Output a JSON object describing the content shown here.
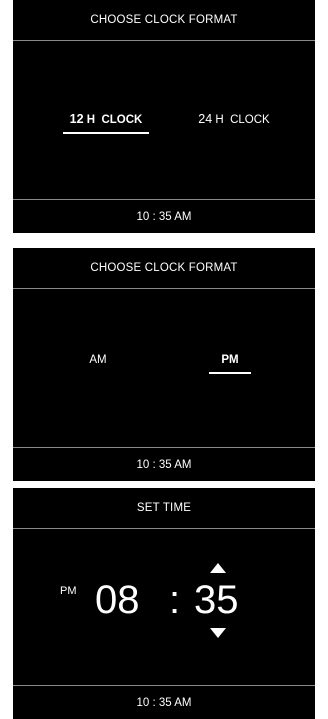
{
  "screens": [
    {
      "header": "CHOOSE CLOCK FORMAT",
      "options": [
        {
          "num": "12",
          "unit": "H",
          "label": "CLOCK",
          "selected": true
        },
        {
          "num": "24",
          "unit": "H",
          "label": "CLOCK",
          "selected": false
        }
      ],
      "footer": "10 : 35 AM"
    },
    {
      "header": "CHOOSE CLOCK FORMAT",
      "options": [
        {
          "label": "AM",
          "selected": false
        },
        {
          "label": "PM",
          "selected": true
        }
      ],
      "footer": "10 : 35 AM"
    },
    {
      "header": "SET TIME",
      "ampm": "PM",
      "hours": "08",
      "separator": ":",
      "minutes": "35",
      "footer": "10 : 35 AM"
    }
  ],
  "colors": {
    "background": "#000000",
    "text": "#ffffff",
    "divider": "#8a8a8a"
  },
  "icons": {
    "increment": "triangle-up",
    "decrement": "triangle-down"
  }
}
